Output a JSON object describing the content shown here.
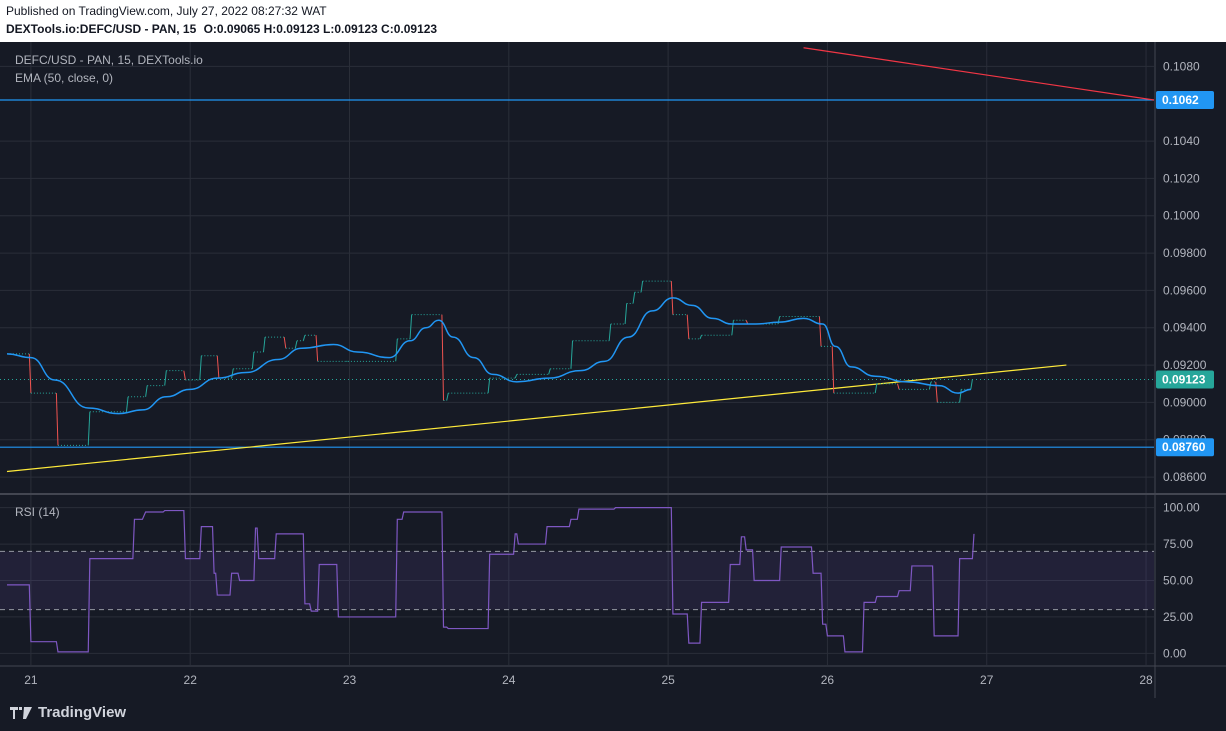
{
  "header": {
    "published": "Published on TradingView.com, July 27, 2022 08:27:32 WAT",
    "symbol": "DEXTools.io:DEFC/USD - PAN, 15",
    "ohlc": "O:0.09065 H:0.09123 L:0.09123 C:0.09123"
  },
  "legend": {
    "title": "DEFC/USD - PAN, 15, DEXTools.io",
    "ema": "EMA (50, close, 0)",
    "rsi": "RSI (14)"
  },
  "footer": {
    "brand": "TradingView",
    "logo_icon": "tradingview-logo-icon"
  },
  "colors": {
    "background": "#161a25",
    "grid": "#2a2e39",
    "axis_text": "#b2b5be",
    "up": "#26a69a",
    "down": "#ef5350",
    "ema": "#2196f3",
    "trend_up": "#ffeb3b",
    "trend_down": "#f23645",
    "hline": "#2196f3",
    "rsi": "#7e57c2",
    "rsi_band": "#7e57c2",
    "last_price": "#26a69a"
  },
  "chart_data": [
    {
      "type": "line",
      "name": "price",
      "x_ticks": [
        "21",
        "22",
        "23",
        "24",
        "25",
        "26",
        "27",
        "28"
      ],
      "x_tick_values": [
        21,
        22,
        23,
        24,
        25,
        26,
        27,
        28
      ],
      "xlim": [
        20.85,
        28.05
      ],
      "ylim": [
        0.0852,
        0.1092
      ],
      "y_ticks": [
        "0.1080",
        "0.1040",
        "0.1020",
        "0.1000",
        "0.09800",
        "0.09600",
        "0.09400",
        "0.09200",
        "0.09000",
        "0.08800",
        "0.08600"
      ],
      "y_tick_values": [
        0.108,
        0.104,
        0.102,
        0.1,
        0.098,
        0.096,
        0.094,
        0.092,
        0.09,
        0.088,
        0.086
      ],
      "price_labels": [
        {
          "text": "0.1062",
          "value": 0.1062,
          "kind": "hline"
        },
        {
          "text": "0.09123",
          "value": 0.09123,
          "kind": "last"
        },
        {
          "text": "0.08760",
          "value": 0.0876,
          "kind": "hline"
        }
      ],
      "price_series": [
        [
          20.85,
          0.0926
        ],
        [
          20.99,
          0.0926
        ],
        [
          21.0,
          0.0905
        ],
        [
          21.16,
          0.0905
        ],
        [
          21.17,
          0.0877
        ],
        [
          21.36,
          0.0877
        ],
        [
          21.37,
          0.0895
        ],
        [
          21.6,
          0.0895
        ],
        [
          21.61,
          0.0903
        ],
        [
          21.72,
          0.0903
        ],
        [
          21.73,
          0.0909
        ],
        [
          21.84,
          0.0909
        ],
        [
          21.85,
          0.0917
        ],
        [
          21.96,
          0.0917
        ],
        [
          21.97,
          0.0912
        ],
        [
          22.06,
          0.0912
        ],
        [
          22.07,
          0.0925
        ],
        [
          22.17,
          0.0925
        ],
        [
          22.18,
          0.0913
        ],
        [
          22.26,
          0.0913
        ],
        [
          22.27,
          0.0918
        ],
        [
          22.39,
          0.0918
        ],
        [
          22.4,
          0.0927
        ],
        [
          22.46,
          0.0927
        ],
        [
          22.47,
          0.0935
        ],
        [
          22.59,
          0.0935
        ],
        [
          22.6,
          0.0929
        ],
        [
          22.66,
          0.0929
        ],
        [
          22.67,
          0.0933
        ],
        [
          22.71,
          0.0933
        ],
        [
          22.72,
          0.0936
        ],
        [
          22.79,
          0.0936
        ],
        [
          22.8,
          0.0922
        ],
        [
          22.98,
          0.0922
        ],
        [
          22.99,
          0.0922
        ],
        [
          23.29,
          0.0922
        ],
        [
          23.3,
          0.0934
        ],
        [
          23.38,
          0.0934
        ],
        [
          23.39,
          0.0947
        ],
        [
          23.58,
          0.0947
        ],
        [
          23.59,
          0.0901
        ],
        [
          23.61,
          0.0901
        ],
        [
          23.62,
          0.0905
        ],
        [
          23.87,
          0.0905
        ],
        [
          23.88,
          0.0913
        ],
        [
          24.04,
          0.0913
        ],
        [
          24.05,
          0.0915
        ],
        [
          24.25,
          0.0915
        ],
        [
          24.26,
          0.0918
        ],
        [
          24.39,
          0.0918
        ],
        [
          24.4,
          0.0933
        ],
        [
          24.63,
          0.0933
        ],
        [
          24.64,
          0.0942
        ],
        [
          24.73,
          0.0942
        ],
        [
          24.74,
          0.0953
        ],
        [
          24.78,
          0.0953
        ],
        [
          24.79,
          0.0959
        ],
        [
          24.83,
          0.0959
        ],
        [
          24.84,
          0.0965
        ],
        [
          25.02,
          0.0965
        ],
        [
          25.03,
          0.0947
        ],
        [
          25.12,
          0.0947
        ],
        [
          25.13,
          0.0934
        ],
        [
          25.2,
          0.0934
        ],
        [
          25.21,
          0.0936
        ],
        [
          25.4,
          0.0936
        ],
        [
          25.41,
          0.0944
        ],
        [
          25.49,
          0.0944
        ],
        [
          25.5,
          0.0942
        ],
        [
          25.69,
          0.0942
        ],
        [
          25.7,
          0.0946
        ],
        [
          25.95,
          0.0946
        ],
        [
          25.96,
          0.093
        ],
        [
          26.03,
          0.093
        ],
        [
          26.04,
          0.0905
        ],
        [
          26.3,
          0.0905
        ],
        [
          26.31,
          0.091
        ],
        [
          26.44,
          0.091
        ],
        [
          26.45,
          0.0907
        ],
        [
          26.64,
          0.0907
        ],
        [
          26.65,
          0.0911
        ],
        [
          26.68,
          0.0911
        ],
        [
          26.69,
          0.09
        ],
        [
          26.83,
          0.09
        ],
        [
          26.84,
          0.0907
        ],
        [
          26.9,
          0.0907
        ],
        [
          26.91,
          0.09123
        ]
      ],
      "ema": [
        [
          20.85,
          0.0926
        ],
        [
          21.0,
          0.0924
        ],
        [
          21.15,
          0.0912
        ],
        [
          21.36,
          0.0897
        ],
        [
          21.55,
          0.0894
        ],
        [
          21.7,
          0.0896
        ],
        [
          21.85,
          0.0903
        ],
        [
          22.0,
          0.0907
        ],
        [
          22.17,
          0.0913
        ],
        [
          22.35,
          0.0916
        ],
        [
          22.55,
          0.0923
        ],
        [
          22.7,
          0.0929
        ],
        [
          22.9,
          0.0931
        ],
        [
          23.05,
          0.0927
        ],
        [
          23.25,
          0.0924
        ],
        [
          23.38,
          0.0933
        ],
        [
          23.48,
          0.094
        ],
        [
          23.56,
          0.0944
        ],
        [
          23.65,
          0.0935
        ],
        [
          23.78,
          0.0924
        ],
        [
          23.9,
          0.0915
        ],
        [
          24.05,
          0.0911
        ],
        [
          24.25,
          0.0913
        ],
        [
          24.45,
          0.0917
        ],
        [
          24.6,
          0.0922
        ],
        [
          24.75,
          0.0935
        ],
        [
          24.9,
          0.0949
        ],
        [
          25.03,
          0.0956
        ],
        [
          25.15,
          0.0952
        ],
        [
          25.28,
          0.0945
        ],
        [
          25.4,
          0.0942
        ],
        [
          25.55,
          0.0942
        ],
        [
          25.7,
          0.0943
        ],
        [
          25.85,
          0.0945
        ],
        [
          25.97,
          0.0942
        ],
        [
          26.05,
          0.093
        ],
        [
          26.15,
          0.0919
        ],
        [
          26.3,
          0.0914
        ],
        [
          26.5,
          0.0911
        ],
        [
          26.7,
          0.0909
        ],
        [
          26.82,
          0.0905
        ],
        [
          26.9,
          0.0907
        ]
      ],
      "trend_up": [
        [
          20.85,
          0.0863
        ],
        [
          27.5,
          0.092
        ]
      ],
      "trend_down": [
        [
          25.85,
          0.109
        ],
        [
          28.05,
          0.1062
        ]
      ]
    },
    {
      "type": "line",
      "name": "RSI (14)",
      "ylim": [
        -8,
        108
      ],
      "y_ticks": [
        "100.00",
        "75.00",
        "50.00",
        "25.00",
        "0.00"
      ],
      "y_tick_values": [
        100,
        75,
        50,
        25,
        0
      ],
      "band": [
        30,
        70
      ],
      "values": [
        [
          20.85,
          47
        ],
        [
          20.99,
          47
        ],
        [
          21.0,
          8
        ],
        [
          21.16,
          8
        ],
        [
          21.17,
          1
        ],
        [
          21.36,
          1
        ],
        [
          21.37,
          65
        ],
        [
          21.64,
          65
        ],
        [
          21.65,
          92
        ],
        [
          21.7,
          92
        ],
        [
          21.72,
          97
        ],
        [
          21.83,
          97
        ],
        [
          21.84,
          98
        ],
        [
          21.96,
          98
        ],
        [
          21.97,
          65
        ],
        [
          22.06,
          65
        ],
        [
          22.07,
          87
        ],
        [
          22.14,
          87
        ],
        [
          22.15,
          55
        ],
        [
          22.16,
          55
        ],
        [
          22.17,
          40
        ],
        [
          22.25,
          40
        ],
        [
          22.26,
          55
        ],
        [
          22.3,
          55
        ],
        [
          22.31,
          50
        ],
        [
          22.4,
          50
        ],
        [
          22.41,
          86
        ],
        [
          22.42,
          86
        ],
        [
          22.43,
          65
        ],
        [
          22.53,
          65
        ],
        [
          22.54,
          82
        ],
        [
          22.71,
          82
        ],
        [
          22.72,
          34
        ],
        [
          22.75,
          34
        ],
        [
          22.76,
          29
        ],
        [
          22.8,
          29
        ],
        [
          22.81,
          61
        ],
        [
          22.92,
          61
        ],
        [
          22.93,
          25
        ],
        [
          23.29,
          25
        ],
        [
          23.3,
          92
        ],
        [
          23.33,
          92
        ],
        [
          23.34,
          97
        ],
        [
          23.58,
          97
        ],
        [
          23.59,
          18
        ],
        [
          23.61,
          18
        ],
        [
          23.62,
          17
        ],
        [
          23.87,
          17
        ],
        [
          23.88,
          68
        ],
        [
          24.03,
          68
        ],
        [
          24.04,
          82
        ],
        [
          24.05,
          82
        ],
        [
          24.06,
          75
        ],
        [
          24.23,
          75
        ],
        [
          24.24,
          87
        ],
        [
          24.38,
          87
        ],
        [
          24.39,
          92
        ],
        [
          24.43,
          92
        ],
        [
          24.44,
          99
        ],
        [
          24.66,
          99
        ],
        [
          24.67,
          100
        ],
        [
          25.02,
          100
        ],
        [
          25.03,
          27
        ],
        [
          25.12,
          27
        ],
        [
          25.13,
          7
        ],
        [
          25.2,
          7
        ],
        [
          25.21,
          35
        ],
        [
          25.38,
          35
        ],
        [
          25.39,
          61
        ],
        [
          25.45,
          61
        ],
        [
          25.46,
          80
        ],
        [
          25.48,
          80
        ],
        [
          25.49,
          71
        ],
        [
          25.53,
          71
        ],
        [
          25.54,
          50
        ],
        [
          25.7,
          50
        ],
        [
          25.71,
          73
        ],
        [
          25.9,
          73
        ],
        [
          25.91,
          55
        ],
        [
          25.96,
          55
        ],
        [
          25.97,
          20
        ],
        [
          25.99,
          20
        ],
        [
          26.0,
          12
        ],
        [
          26.1,
          12
        ],
        [
          26.11,
          1
        ],
        [
          26.22,
          1
        ],
        [
          26.23,
          35
        ],
        [
          26.3,
          35
        ],
        [
          26.31,
          39
        ],
        [
          26.44,
          39
        ],
        [
          26.45,
          43
        ],
        [
          26.52,
          43
        ],
        [
          26.53,
          60
        ],
        [
          26.66,
          60
        ],
        [
          26.67,
          12
        ],
        [
          26.82,
          12
        ],
        [
          26.83,
          65
        ],
        [
          26.91,
          65
        ],
        [
          26.92,
          82
        ]
      ]
    }
  ]
}
